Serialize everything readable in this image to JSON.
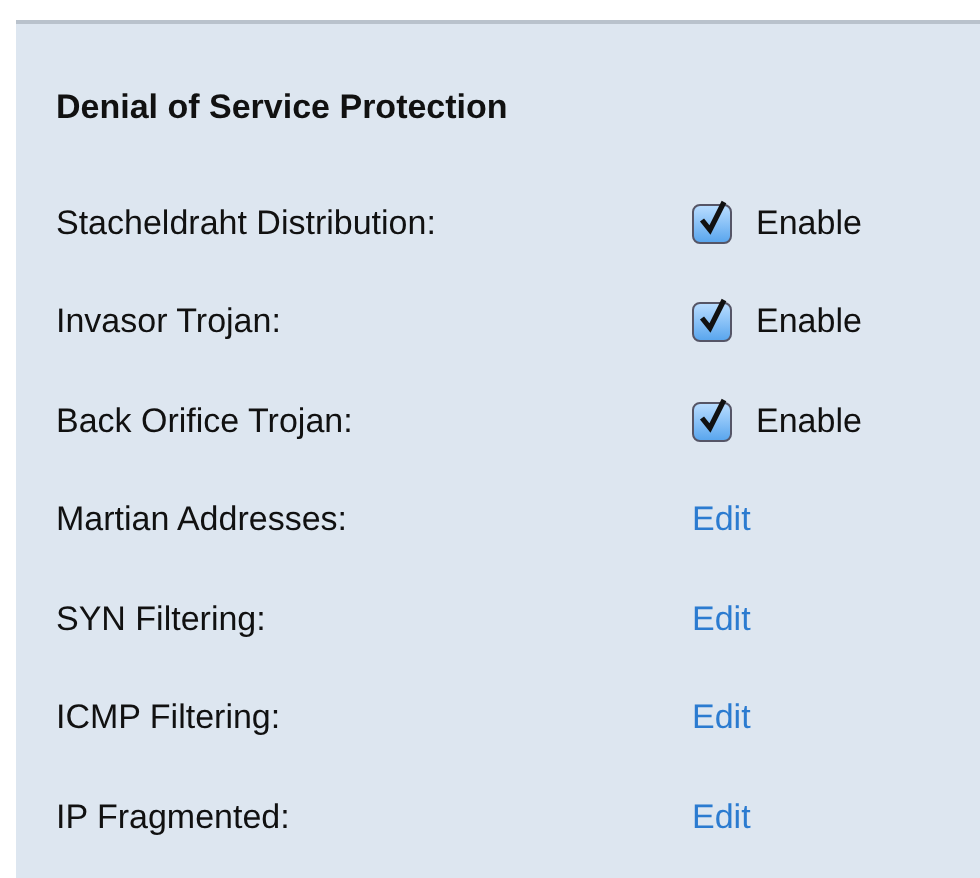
{
  "section": {
    "title": "Denial of Service Protection"
  },
  "rows": [
    {
      "kind": "checkbox",
      "label": "Stacheldraht Distribution:",
      "checked": true,
      "option": "Enable"
    },
    {
      "kind": "checkbox",
      "label": "Invasor Trojan:",
      "checked": true,
      "option": "Enable"
    },
    {
      "kind": "checkbox",
      "label": "Back Orifice Trojan:",
      "checked": true,
      "option": "Enable"
    },
    {
      "kind": "link",
      "label": "Martian Addresses:",
      "link": "Edit"
    },
    {
      "kind": "link",
      "label": "SYN Filtering:",
      "link": "Edit"
    },
    {
      "kind": "link",
      "label": "ICMP Filtering:",
      "link": "Edit"
    },
    {
      "kind": "link",
      "label": "IP Fragmented:",
      "link": "Edit"
    }
  ]
}
